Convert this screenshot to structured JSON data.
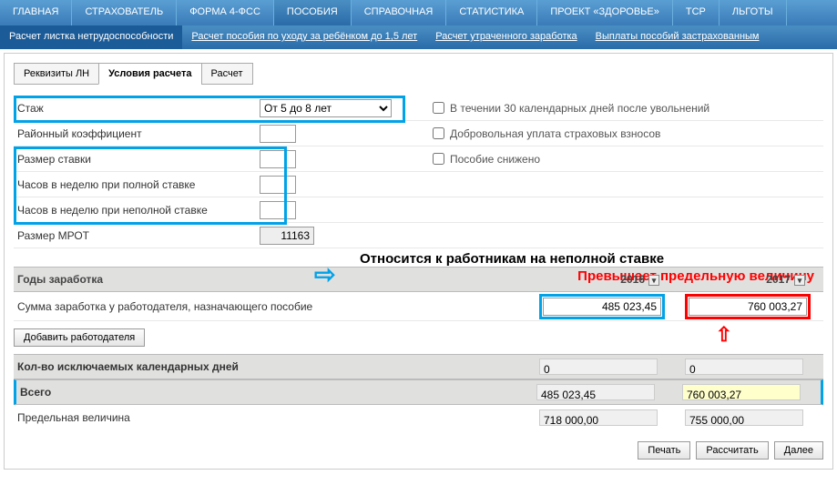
{
  "topnav": [
    "ГЛАВНАЯ",
    "СТРАХОВАТЕЛЬ",
    "ФОРМА 4-ФСС",
    "ПОСОБИЯ",
    "СПРАВОЧНАЯ",
    "СТАТИСТИКА",
    "ПРОЕКТ «ЗДОРОВЬЕ»",
    "ТСР",
    "ЛЬГОТЫ"
  ],
  "topnav_active": 3,
  "subnav": [
    "Расчет листка нетрудоспособности",
    "Расчет пособия по уходу за ребёнком до 1,5 лет",
    "Расчет утраченного заработка",
    "Выплаты пособий застрахованным"
  ],
  "subnav_active": 0,
  "tabs": [
    "Реквизиты ЛН",
    "Условия расчета",
    "Расчет"
  ],
  "tabs_active": 1,
  "form": {
    "stazh_label": "Стаж",
    "stazh_value": "От 5 до 8 лет",
    "raion_label": "Районный коэффициент",
    "razmer_label": "Размер ставки",
    "hours_full_label": "Часов в неделю при полной ставке",
    "hours_part_label": "Часов в неделю при неполной ставке",
    "mrot_label": "Размер МРОТ",
    "mrot_value": "11163",
    "chk1": "В течении 30 календарных дней после увольнений",
    "chk2": "Добровольная уплата страховых взносов",
    "chk3": "Пособие снижено"
  },
  "anno1": "Относится к работникам на неполной ставке",
  "anno2": "Превышает предельную величину",
  "years": {
    "header": "Годы заработка",
    "y1": "2016",
    "y2": "2017",
    "sum_label": "Сумма заработка у работодателя, назначающего пособие",
    "sum_v1": "485 023,45",
    "sum_v2": "760 003,27",
    "add_emp": "Добавить работодателя",
    "excl_label": "Кол-во исключаемых календарных дней",
    "excl_v1": "0",
    "excl_v2": "0",
    "total_label": "Всего",
    "total_v1": "485 023,45",
    "total_v2": "760 003,27",
    "limit_label": "Предельная величина",
    "limit_v1": "718 000,00",
    "limit_v2": "755 000,00"
  },
  "buttons": {
    "print": "Печать",
    "calc": "Рассчитать",
    "next": "Далее"
  }
}
